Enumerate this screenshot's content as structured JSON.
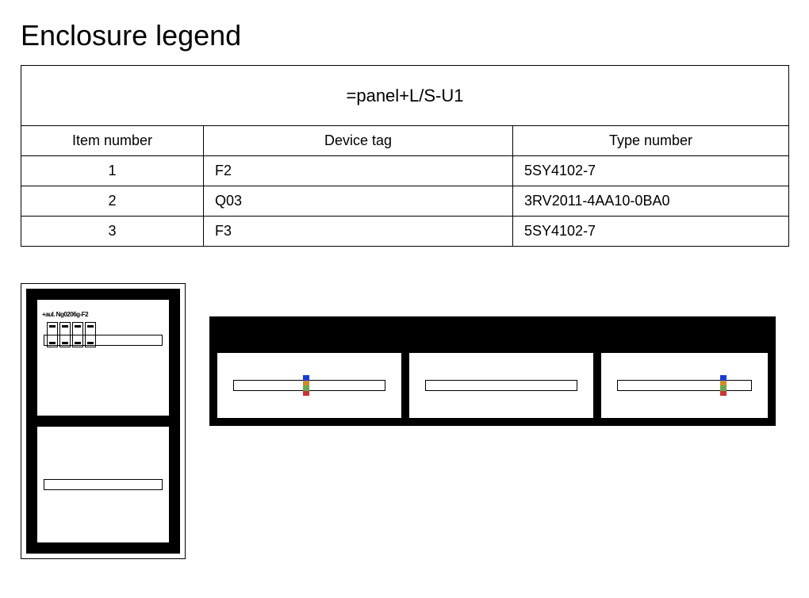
{
  "title": "Enclosure legend",
  "table": {
    "banner": "=panel+L/S-U1",
    "headers": {
      "item": "Item number",
      "tag": "Device tag",
      "type": "Type number"
    },
    "rows": [
      {
        "item": "1",
        "tag": "F2",
        "type": "5SY4102-7"
      },
      {
        "item": "2",
        "tag": "Q03",
        "type": "3RV2011-4AA10-0BA0"
      },
      {
        "item": "3",
        "tag": "F3",
        "type": "5SY4102-7"
      }
    ]
  },
  "enclosure_label": "+aul. Ng0206g-F2"
}
